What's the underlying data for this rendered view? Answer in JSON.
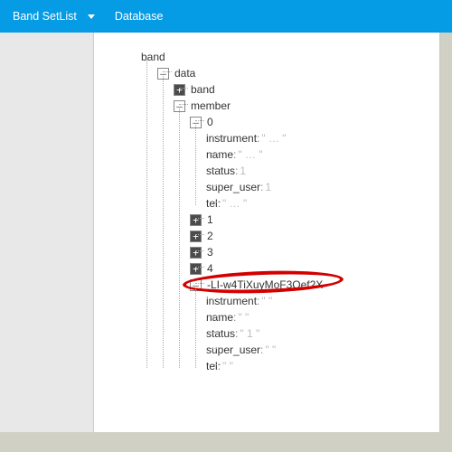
{
  "header": {
    "app_name": "Band SetList",
    "active_tab": "Database"
  },
  "tree": {
    "root": "band",
    "data_label": "data",
    "band_label": "band",
    "member_label": "member",
    "m0": {
      "idx": "0",
      "instrument_k": "instrument",
      "instrument_v": "\" …   \"",
      "name_k": "name",
      "name_v": "\" … \"",
      "status_k": "status",
      "status_v": "1",
      "super_user_k": "super_user",
      "super_user_v": "1",
      "tel_k": "tel",
      "tel_v": "\" …   \""
    },
    "m1": "1",
    "m2": "2",
    "m3": "3",
    "m4": "4",
    "push": {
      "key": "-LI-w4TiXuyMoF3Qef2X",
      "instrument_k": "instrument",
      "instrument_v": "\" \"",
      "name_k": "name",
      "name_v": "\" \"",
      "status_k": "status",
      "status_v": "\" 1 \"",
      "super_user_k": "super_user",
      "super_user_v": "\" \"",
      "tel_k": "tel",
      "tel_v": "\" \""
    }
  }
}
